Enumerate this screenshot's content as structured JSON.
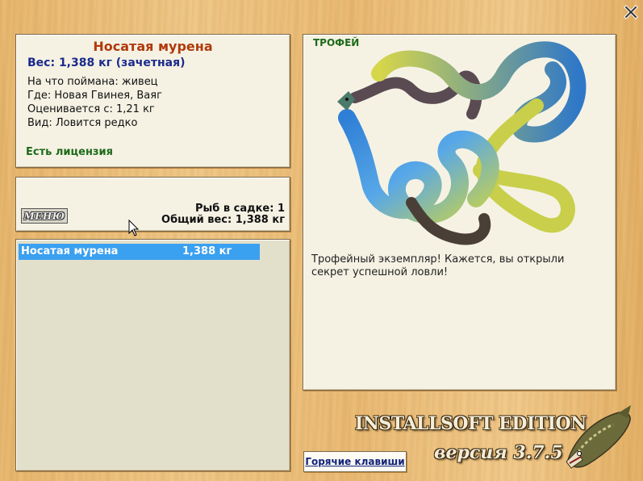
{
  "info": {
    "fish_name": "Носатая мурена",
    "weight_line": "Вес: 1,388 кг (зачетная)",
    "caught_on": "На что поймана: живец",
    "location": "Где: Новая Гвинея, Ваяг",
    "valued_from": "Оценивается с: 1,21 кг",
    "species_type": "Вид: Ловится редко",
    "license": "Есть лицензия"
  },
  "cage": {
    "menu_label": "МЕНЮ",
    "fish_count": "Рыб в садке: 1",
    "total_weight": "Общий вес: 1,388 кг"
  },
  "catch_list": [
    {
      "name": "Носатая мурена",
      "weight": "1,388 кг"
    }
  ],
  "trophy": {
    "title": "ТРОФЕЙ",
    "description": "Трофейный экземпляр! Кажется, вы открыли секрет успешной ловли!"
  },
  "footer": {
    "brand": "INSTALLSOFT EDITION",
    "version": "версия 3.7.5",
    "hotkeys_label": "Горячие клавиши"
  },
  "icons": {
    "close": "close-icon",
    "eel": "moray-eel-image",
    "pike": "pike-logo",
    "cursor": "mouse-cursor-icon"
  },
  "colors": {
    "fish_name": "#b03a0b",
    "weight": "#1b2a8c",
    "license": "#1e6a1a",
    "list_selection": "#3aa0f0"
  }
}
